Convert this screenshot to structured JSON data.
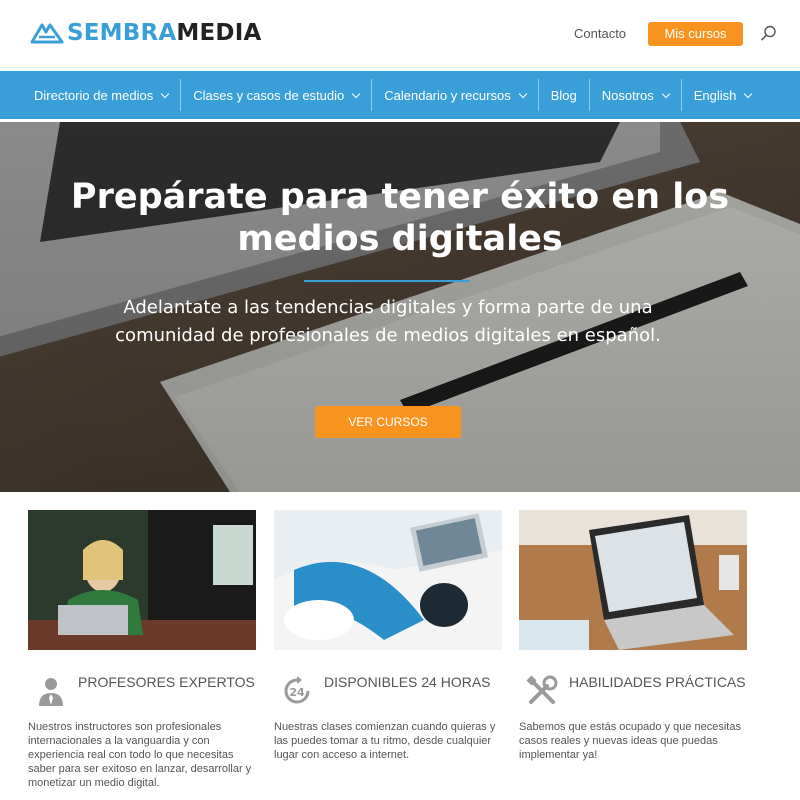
{
  "header": {
    "logo_part1": "SEMBRA",
    "logo_part2": "MEDIA",
    "contact_label": "Contacto",
    "courses_button": "Mis cursos",
    "search_icon": "search-icon"
  },
  "nav": {
    "items": [
      {
        "label": "Directorio de medios",
        "has_dropdown": true
      },
      {
        "label": "Clases y casos de estudio",
        "has_dropdown": true
      },
      {
        "label": "Calendario y recursos",
        "has_dropdown": true
      },
      {
        "label": "Blog",
        "has_dropdown": false
      },
      {
        "label": "Nosotros",
        "has_dropdown": true
      },
      {
        "label": "English",
        "has_dropdown": true
      }
    ]
  },
  "hero": {
    "title": "Prepárate para tener éxito en los medios digitales",
    "subtitle": "Adelantate a las tendencias digitales y forma parte de una comunidad de profesionales de medios digitales en español.",
    "button": "VER CURSOS"
  },
  "features": [
    {
      "icon": "instructor-icon",
      "title": "PROFESORES EXPERTOS",
      "description": "Nuestros instructores son profesionales internacionales a la vanguardia y con experiencia real con todo lo que necesitas saber para ser exitoso en lanzar, desarrollar y monetizar un medio digital."
    },
    {
      "icon": "clock-24-icon",
      "title": "DISPONIBLES 24 HORAS",
      "description": "Nuestras clases comienzan cuando quieras y las puedes tomar a tu ritmo, desde cualquier lugar con acceso a internet."
    },
    {
      "icon": "tools-icon",
      "title": "HABILIDADES PRÁCTICAS",
      "description": "Sabemos que estás ocupado y que necesitas casos reales y nuevas ideas que puedas implementar ya!"
    }
  ],
  "colors": {
    "brand_blue": "#3a9fd8",
    "accent_orange": "#f7931e"
  }
}
